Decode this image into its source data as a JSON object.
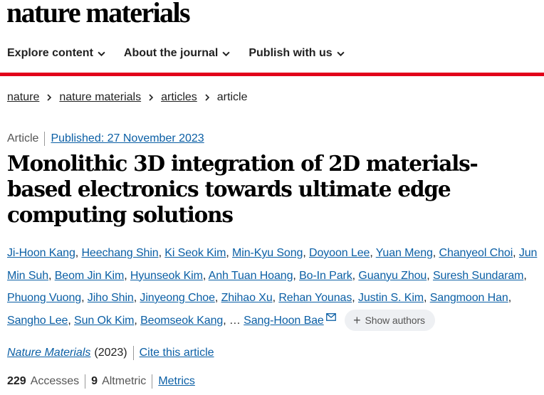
{
  "site": {
    "logo": "nature materials"
  },
  "nav": {
    "items": [
      {
        "label": "Explore content"
      },
      {
        "label": "About the journal"
      },
      {
        "label": "Publish with us"
      }
    ]
  },
  "breadcrumb": {
    "items": [
      "nature",
      "nature materials",
      "articles"
    ],
    "current": "article"
  },
  "article": {
    "type": "Article",
    "published": "Published: 27 November 2023",
    "title": "Monolithic 3D integration of 2D materials-based electronics towards ultimate edge computing solutions",
    "authors": [
      "Ji-Hoon Kang",
      "Heechang Shin",
      "Ki Seok Kim",
      "Min-Kyu Song",
      "Doyoon Lee",
      "Yuan Meng",
      "Chanyeol Choi",
      "Jun Min Suh",
      "Beom Jin Kim",
      "Hyunseok Kim",
      "Anh Tuan Hoang",
      "Bo-In Park",
      "Guanyu Zhou",
      "Suresh Sundaram",
      "Phuong Vuong",
      "Jiho Shin",
      "Jinyeong Choe",
      "Zhihao Xu",
      "Rehan Younas",
      "Justin S. Kim",
      "Sangmoon Han",
      "Sangho Lee",
      "Sun Ok Kim",
      "Beomseok Kang"
    ],
    "ellipsis": "…",
    "last_author": "Sang-Hoon Bae",
    "show_authors": "Show authors",
    "journal": "Nature Materials",
    "year": "(2023)",
    "cite": "Cite this article"
  },
  "metrics": {
    "accesses_count": "229",
    "accesses_label": "Accesses",
    "altmetric_count": "9",
    "altmetric_label": "Altmetric",
    "metrics_link": "Metrics"
  }
}
